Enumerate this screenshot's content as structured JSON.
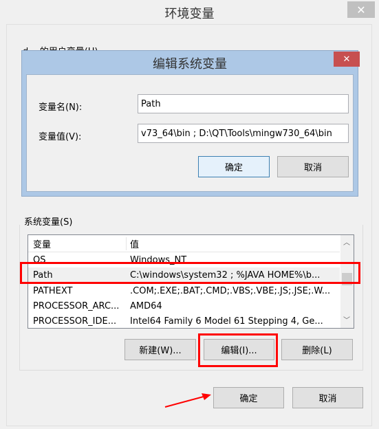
{
  "window": {
    "title": "环境变量",
    "user_vars_label": "d... 的用户变量(U)"
  },
  "edit_dialog": {
    "title": "编辑系统变量",
    "name_label": "变量名(N):",
    "name_value": "Path",
    "value_label": "变量值(V):",
    "value_value": "v73_64\\bin ; D:\\QT\\Tools\\mingw730_64\\bin",
    "ok": "确定",
    "cancel": "取消"
  },
  "system_vars": {
    "label": "系统变量(S)",
    "headers": [
      "变量",
      "值"
    ],
    "rows": [
      {
        "name": "OS",
        "value": "Windows_NT"
      },
      {
        "name": "Path",
        "value": "C:\\windows\\system32 ; %JAVA HOME%\\b..."
      },
      {
        "name": "PATHEXT",
        "value": ".COM;.EXE;.BAT;.CMD;.VBS;.VBE;.JS;.JSE;.W..."
      },
      {
        "name": "PROCESSOR_ARC...",
        "value": "AMD64"
      },
      {
        "name": "PROCESSOR_IDE...",
        "value": "Intel64 Family 6 Model 61 Stepping 4, Ge..."
      }
    ],
    "new": "新建(W)...",
    "edit": "编辑(I)...",
    "delete": "删除(L)"
  },
  "footer": {
    "ok": "确定",
    "cancel": "取消"
  },
  "colors": {
    "annotation": "#ff0000",
    "dialog_frame": "#adc8e6",
    "close_red": "#c75050"
  }
}
